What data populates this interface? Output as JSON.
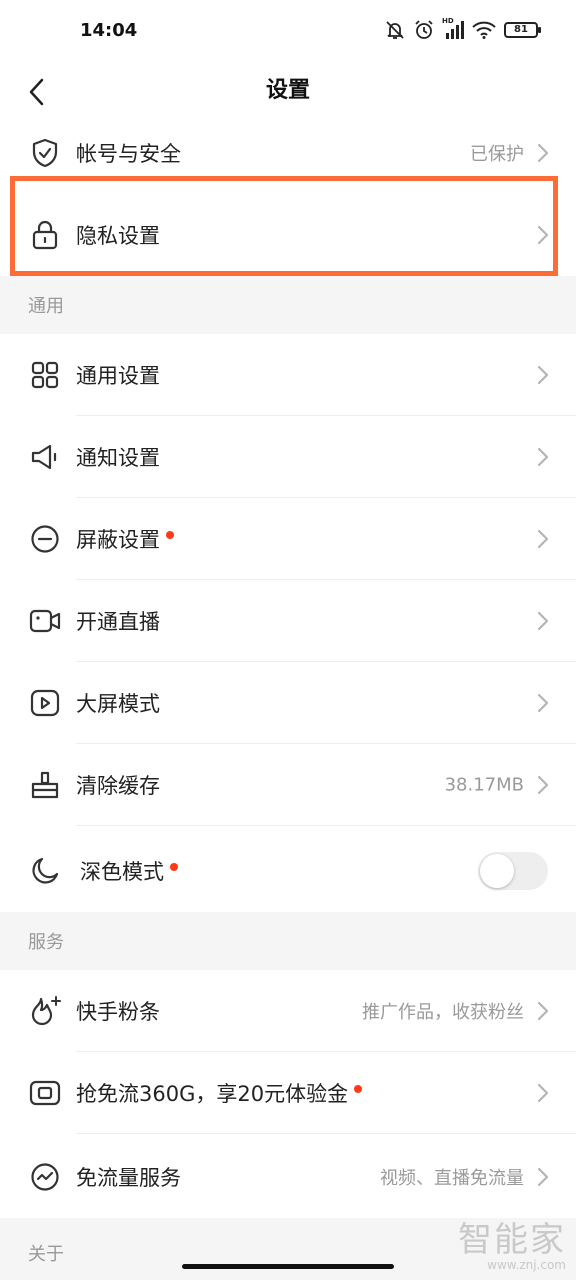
{
  "status_bar": {
    "time": "14:04",
    "battery": "81",
    "network_label": "HD"
  },
  "header": {
    "title": "设置"
  },
  "rows": {
    "account": {
      "label": "帐号与安全",
      "value": "已保护"
    },
    "privacy": {
      "label": "隐私设置"
    },
    "general": {
      "label": "通用设置"
    },
    "notification": {
      "label": "通知设置"
    },
    "block": {
      "label": "屏蔽设置"
    },
    "live": {
      "label": "开通直播"
    },
    "bigscreen": {
      "label": "大屏模式"
    },
    "cache": {
      "label": "清除缓存",
      "value": "38.17MB"
    },
    "darkmode": {
      "label": "深色模式",
      "enabled": false
    },
    "fans": {
      "label": "快手粉条",
      "value": "推广作品，收获粉丝"
    },
    "freeflow360": {
      "label": "抢免流360G，享20元体验金"
    },
    "freeflow": {
      "label": "免流量服务",
      "value": "视频、直播免流量"
    }
  },
  "sections": {
    "general": "通用",
    "services": "服务",
    "about": "关于"
  },
  "watermark": {
    "name": "智能家",
    "url": "www.znj.com"
  },
  "colors": {
    "highlight": "#fd6c36",
    "dot": "#fe3a16",
    "section_bg": "#f5f5f5",
    "muted_text": "#9a9a9a"
  }
}
